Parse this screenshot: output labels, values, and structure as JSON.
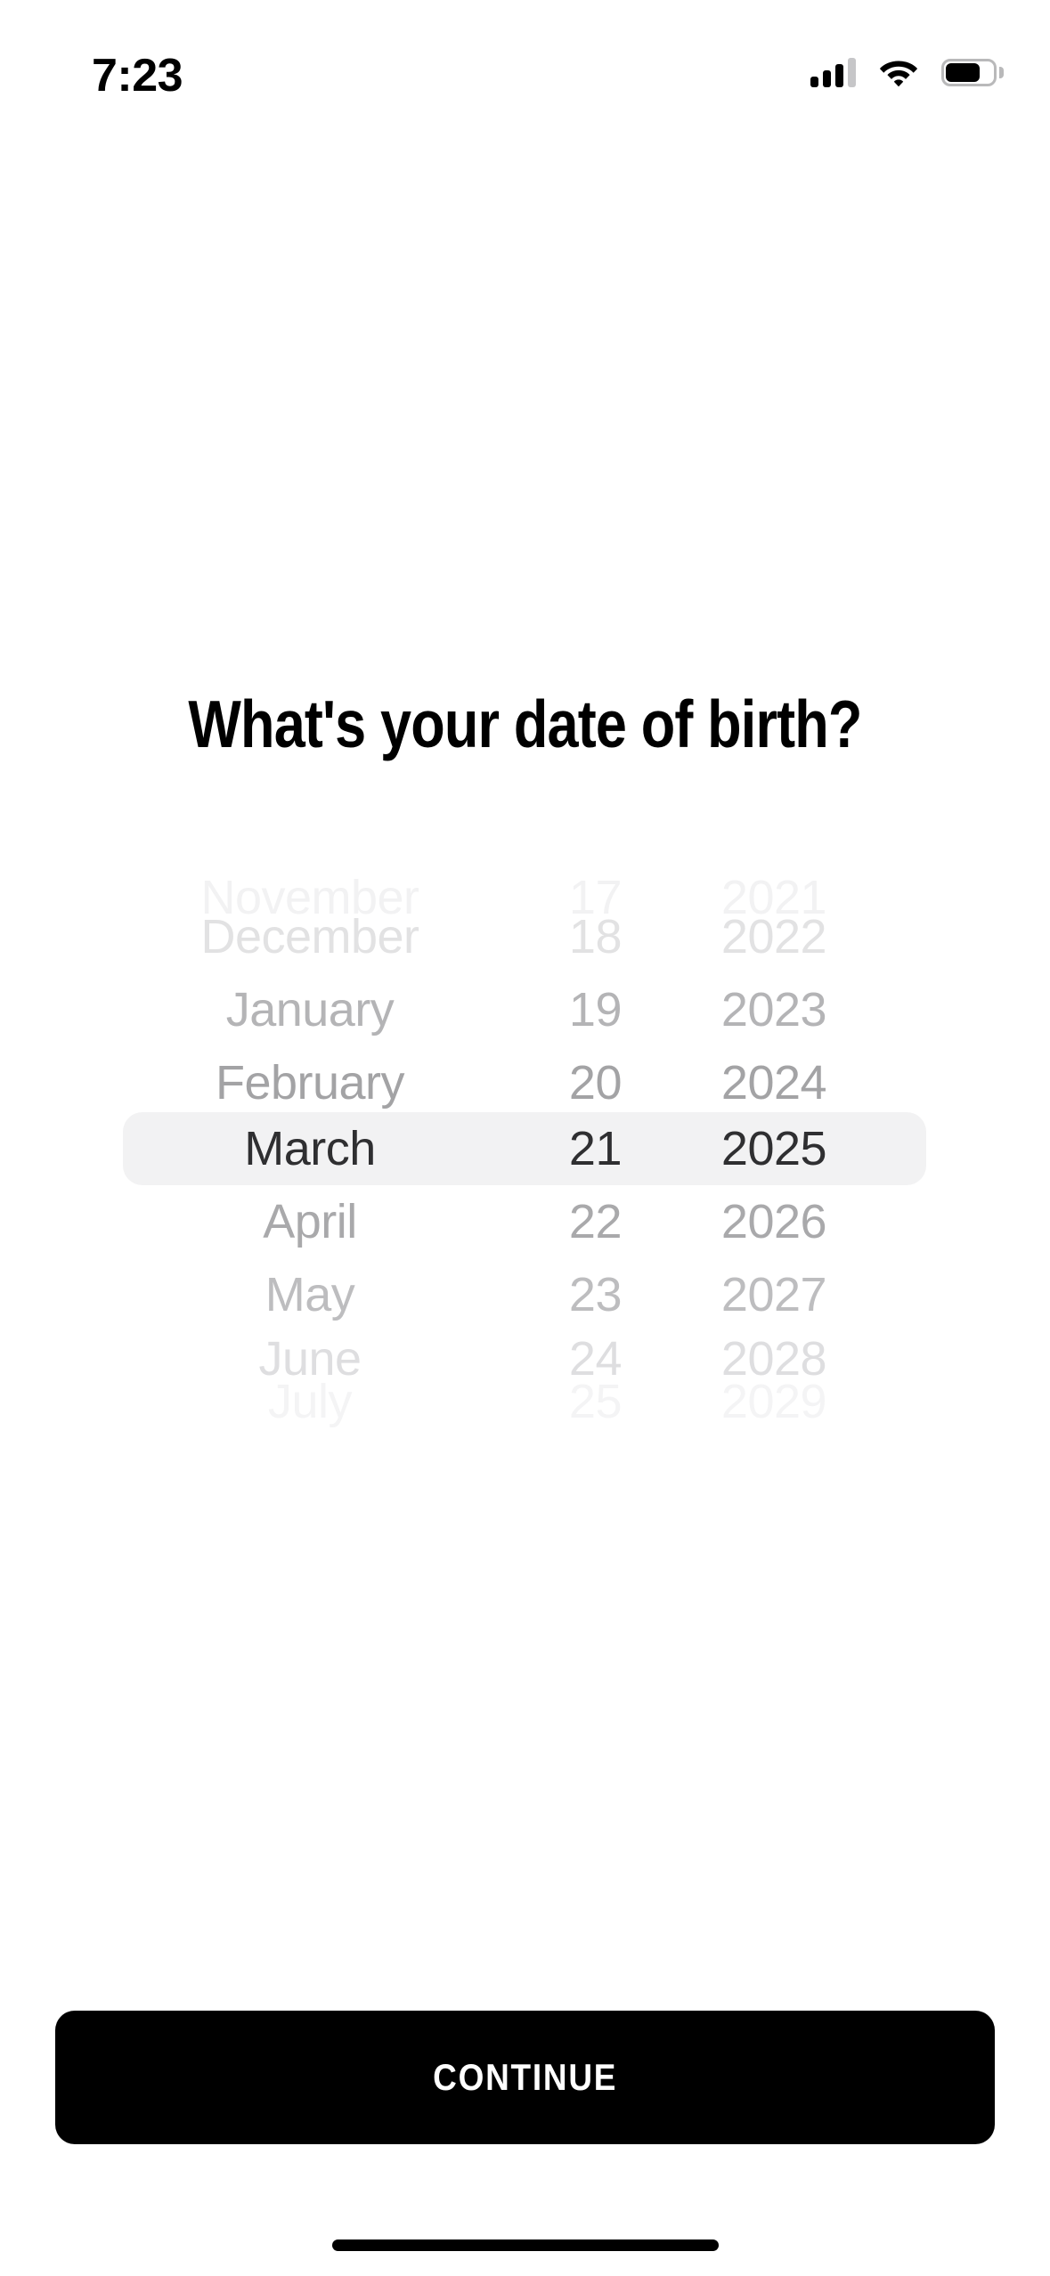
{
  "status_bar": {
    "time": "7:23",
    "cellular_icon": "cellular-signal-icon",
    "cellular_bars_total": 4,
    "cellular_bars_filled": 3,
    "wifi_icon": "wifi-icon",
    "battery_icon": "battery-icon",
    "battery_level_percent": 78
  },
  "page_title": "What's your date of birth?",
  "date_picker": {
    "selected": {
      "month": "March",
      "day": "21",
      "year": "2025"
    },
    "rows": [
      {
        "month": "November",
        "day": "17",
        "year": "2021",
        "selected": false
      },
      {
        "month": "December",
        "day": "18",
        "year": "2022",
        "selected": false
      },
      {
        "month": "January",
        "day": "19",
        "year": "2023",
        "selected": false
      },
      {
        "month": "February",
        "day": "20",
        "year": "2024",
        "selected": false
      },
      {
        "month": "March",
        "day": "21",
        "year": "2025",
        "selected": true
      },
      {
        "month": "April",
        "day": "22",
        "year": "2026",
        "selected": false
      },
      {
        "month": "May",
        "day": "23",
        "year": "2027",
        "selected": false
      },
      {
        "month": "June",
        "day": "24",
        "year": "2028",
        "selected": false
      },
      {
        "month": "July",
        "day": "25",
        "year": "2029",
        "selected": false
      }
    ],
    "highlight_color": "#f2f2f3",
    "selected_text_color": "#2f2f31"
  },
  "continue_button": {
    "label": "CONTINUE",
    "background_color": "#000000",
    "text_color": "#ffffff"
  },
  "home_indicator": {
    "color": "#000000"
  }
}
